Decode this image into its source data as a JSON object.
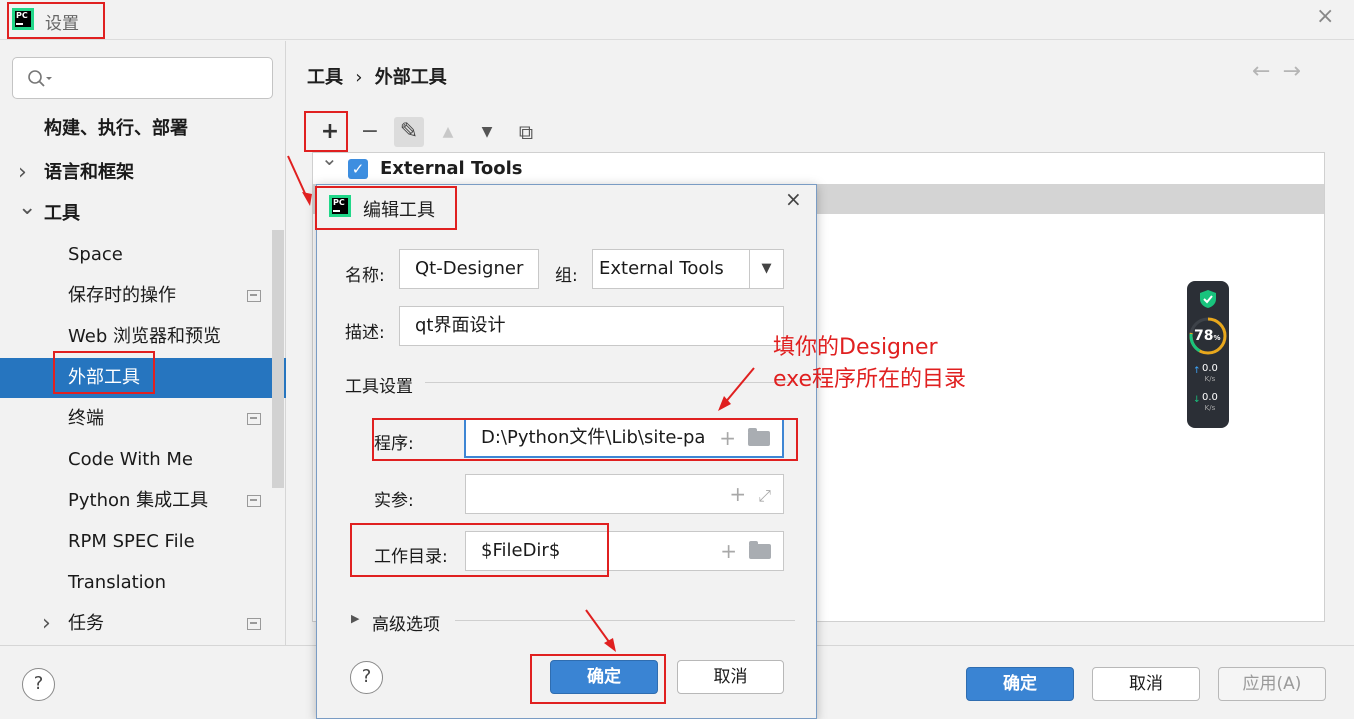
{
  "window": {
    "title": "设置",
    "close_glyph": "×",
    "logo_text": "PC"
  },
  "search": {
    "placeholder": "",
    "icon": "search-icon"
  },
  "sidebar": {
    "items": [
      {
        "label": "构建、执行、部署",
        "bold": true,
        "chevron": "",
        "page_icon": false
      },
      {
        "label": "语言和框架",
        "bold": true,
        "chevron": "›",
        "page_icon": false
      },
      {
        "label": "工具",
        "bold": true,
        "chevron": "⌄",
        "page_icon": false
      },
      {
        "label": "Space",
        "bold": false,
        "chevron": "",
        "page_icon": false
      },
      {
        "label": "保存时的操作",
        "bold": false,
        "chevron": "",
        "page_icon": true
      },
      {
        "label": "Web 浏览器和预览",
        "bold": false,
        "chevron": "",
        "page_icon": false
      },
      {
        "label": "外部工具",
        "bold": false,
        "chevron": "",
        "page_icon": false,
        "selected": true
      },
      {
        "label": "终端",
        "bold": false,
        "chevron": "",
        "page_icon": true
      },
      {
        "label": "Code With Me",
        "bold": false,
        "chevron": "",
        "page_icon": false
      },
      {
        "label": "Python 集成工具",
        "bold": false,
        "chevron": "",
        "page_icon": true
      },
      {
        "label": "RPM SPEC File",
        "bold": false,
        "chevron": "",
        "page_icon": false
      },
      {
        "label": "Translation",
        "bold": false,
        "chevron": "",
        "page_icon": false
      },
      {
        "label": "任务",
        "bold": false,
        "chevron": "›",
        "page_icon": true
      }
    ]
  },
  "main": {
    "breadcrumb": {
      "parent": "工具",
      "separator": "›",
      "current": "外部工具"
    },
    "nav_back": "←",
    "nav_forward": "→",
    "toolbar": {
      "add": "+",
      "remove": "−",
      "edit": "✎",
      "up": "▲",
      "down": "▼",
      "copy": "⧉"
    },
    "tree": {
      "group_label": "External Tools",
      "group_checked": true,
      "expand_glyph": "⌄"
    }
  },
  "widget": {
    "percent": "78",
    "percent_unit": "%",
    "up_value": "0.0",
    "down_value": "0.0",
    "rate_unit": "K/s",
    "up_arrow": "↑",
    "down_arrow": "↓"
  },
  "dialog": {
    "title": "编辑工具",
    "close_glyph": "×",
    "name_label": "名称:",
    "name_value": "Qt-Designer",
    "group_label": "组:",
    "group_value": "External Tools",
    "group_arrow": "▼",
    "desc_label": "描述:",
    "desc_value": "qt界面设计",
    "section_tool_settings": "工具设置",
    "program_label": "程序:",
    "program_value": "D:\\Python文件\\Lib\\site-pa",
    "args_label": "实参:",
    "args_value": "",
    "workdir_label": "工作目录:",
    "workdir_value": "$FileDir$",
    "plus_glyph": "+",
    "expand_glyph": "⤢",
    "advanced_label": "高级选项",
    "advanced_arrow": "▶",
    "help_glyph": "?",
    "ok_label": "确定",
    "cancel_label": "取消"
  },
  "bottom": {
    "help_glyph": "?",
    "ok_label": "确定",
    "cancel_label": "取消",
    "apply_label": "应用(A)"
  },
  "annotation": {
    "line1": "填你的Designer",
    "line2": "exe程序所在的目录",
    "color": "#e02020"
  }
}
